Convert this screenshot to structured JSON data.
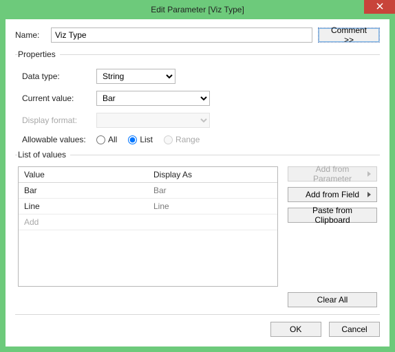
{
  "window": {
    "title": "Edit Parameter [Viz Type]"
  },
  "name": {
    "label": "Name:",
    "value": "Viz Type"
  },
  "comment_button": "Comment >>",
  "properties": {
    "legend": "Properties",
    "data_type": {
      "label": "Data type:",
      "value": "String"
    },
    "current_value": {
      "label": "Current value:",
      "value": "Bar"
    },
    "display_format": {
      "label": "Display format:",
      "value": ""
    },
    "allowable": {
      "label": "Allowable values:",
      "options": {
        "all": "All",
        "list": "List",
        "range": "Range"
      },
      "selected": "list"
    }
  },
  "list": {
    "legend": "List of values",
    "columns": {
      "value": "Value",
      "display": "Display As"
    },
    "rows": [
      {
        "value": "Bar",
        "display": "Bar"
      },
      {
        "value": "Line",
        "display": "Line"
      }
    ],
    "add_row": "Add"
  },
  "side": {
    "add_param": "Add from Parameter",
    "add_field": "Add from Field",
    "paste": "Paste from Clipboard",
    "clear": "Clear All"
  },
  "footer": {
    "ok": "OK",
    "cancel": "Cancel"
  }
}
